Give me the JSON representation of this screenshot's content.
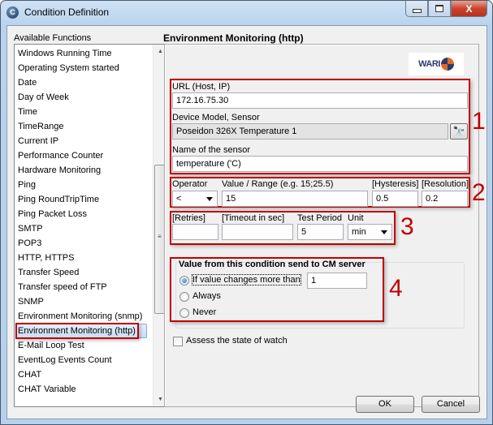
{
  "window": {
    "title": "Condition Definition",
    "app_icon_letter": "C",
    "close_glyph": "X"
  },
  "functions": {
    "label": "Available Functions",
    "items": [
      "Windows Running Time",
      "Operating System started",
      "Date",
      "Day of Week",
      "Time",
      "TimeRange",
      "Current IP",
      "Performance Counter",
      "Hardware Monitoring",
      "Ping",
      "Ping RoundTripTime",
      "Ping Packet Loss",
      "SMTP",
      "POP3",
      "HTTP, HTTPS",
      "Transfer Speed",
      "Transfer speed of FTP",
      "SNMP",
      "Environment Monitoring (snmp)",
      "Environment Monitoring (http)",
      "E-Mail Loop Test",
      "EventLog Events Count",
      "CHAT",
      "CHAT Variable"
    ],
    "selected_index": 19
  },
  "panel": {
    "title": "Environment Monitoring (http)",
    "logo_text": "WARI",
    "section1": {
      "marker": "1",
      "url_label": "URL (Host, IP)",
      "url_value": "172.16.75.30",
      "device_label": "Device Model, Sensor",
      "device_value": "Poseidon 326X Temperature 1",
      "sensor_name_label": "Name of the sensor",
      "sensor_name_value": "temperature ('C)"
    },
    "section2": {
      "marker": "2",
      "operator_label": "Operator",
      "operator_value": "<",
      "value_label": "Value / Range (e.g. 15;25.5)",
      "value_value": "15",
      "hysteresis_label": "[Hysteresis]",
      "hysteresis_value": "0.5",
      "resolution_label": "[Resolution]",
      "resolution_value": "0.2"
    },
    "section3": {
      "marker": "3",
      "retries_label": "[Retries]",
      "retries_value": "",
      "timeout_label": "[Timeout in sec]",
      "timeout_value": "",
      "test_period_label": "Test Period",
      "test_period_value": "5",
      "unit_label": "Unit",
      "unit_value": "min"
    },
    "section4": {
      "marker": "4",
      "group_title": "Value from this condition send to CM server",
      "options": [
        "If value changes more than",
        "Always",
        "Never"
      ],
      "selected_option": 0,
      "threshold_value": "1"
    },
    "assess_label": "Assess the state of watch",
    "assess_checked": false
  },
  "buttons": {
    "ok": "OK",
    "cancel": "Cancel"
  },
  "colors": {
    "annotation_red": "#c00000",
    "selection_blue": "#c8ddf5"
  }
}
